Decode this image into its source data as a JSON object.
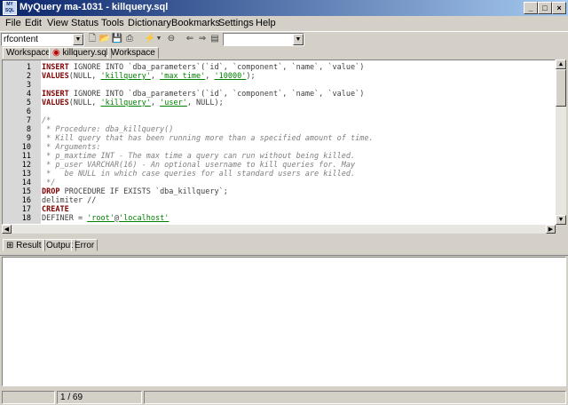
{
  "window": {
    "title": "MyQuery ma-1031 - killquery.sql",
    "icon_text": "MY SQL"
  },
  "menu": [
    "File",
    "Edit",
    "View",
    "Status",
    "Tools",
    "Dictionary",
    "Bookmarks",
    "Settings",
    "Help"
  ],
  "toolbar": {
    "connection_value": "rfcontent",
    "database_value": ""
  },
  "tabs": [
    {
      "label": "Workspace"
    },
    {
      "label": "killquery.sql"
    },
    {
      "label": "Workspace"
    }
  ],
  "editor": {
    "lines": [
      {
        "n": "1",
        "parts": [
          [
            "kw",
            "INSERT"
          ],
          [
            "id",
            " IGNORE INTO `dba_parameters`(`id`, `component`, `name`, `value`)"
          ]
        ]
      },
      {
        "n": "2",
        "parts": [
          [
            "kw",
            "VALUES"
          ],
          [
            "id",
            "(NULL, "
          ],
          [
            "str",
            "'killquery'"
          ],
          [
            "id",
            ", "
          ],
          [
            "str",
            "'max_time'"
          ],
          [
            "id",
            ", "
          ],
          [
            "str",
            "'10000'"
          ],
          [
            "id",
            ");"
          ]
        ]
      },
      {
        "n": "3",
        "parts": []
      },
      {
        "n": "4",
        "parts": [
          [
            "kw",
            "INSERT"
          ],
          [
            "id",
            " IGNORE INTO `dba_parameters`(`id`, `component`, `name`, `value`)"
          ]
        ]
      },
      {
        "n": "5",
        "parts": [
          [
            "kw",
            "VALUES"
          ],
          [
            "id",
            "(NULL, "
          ],
          [
            "str",
            "'killquery'"
          ],
          [
            "id",
            ", "
          ],
          [
            "str",
            "'user'"
          ],
          [
            "id",
            ", NULL);"
          ]
        ]
      },
      {
        "n": "6",
        "parts": []
      },
      {
        "n": "7",
        "parts": [
          [
            "cm",
            "/*"
          ]
        ]
      },
      {
        "n": "8",
        "parts": [
          [
            "cm",
            " * Procedure: dba_killquery()"
          ]
        ]
      },
      {
        "n": "9",
        "parts": [
          [
            "cm",
            " * Kill query that has been running more than a specified amount of time."
          ]
        ]
      },
      {
        "n": "10",
        "parts": [
          [
            "cm",
            " * Arguments:"
          ]
        ]
      },
      {
        "n": "11",
        "parts": [
          [
            "cm",
            " * p_maxtime INT - The max time a query can run without being killed."
          ]
        ]
      },
      {
        "n": "12",
        "parts": [
          [
            "cm",
            " * p_user VARCHAR(16) - An optional username to kill queries for. May"
          ]
        ]
      },
      {
        "n": "13",
        "parts": [
          [
            "cm",
            " *   be NULL in which case queries for all standard users are killed."
          ]
        ]
      },
      {
        "n": "14",
        "parts": [
          [
            "cm",
            " */"
          ]
        ]
      },
      {
        "n": "15",
        "parts": [
          [
            "kw",
            "DROP"
          ],
          [
            "id",
            " PROCEDURE IF EXISTS `dba_killquery`;"
          ]
        ]
      },
      {
        "n": "16",
        "parts": [
          [
            "id",
            "delimiter //"
          ]
        ]
      },
      {
        "n": "17",
        "parts": [
          [
            "kw",
            "CREATE"
          ]
        ]
      },
      {
        "n": "18",
        "parts": [
          [
            "id",
            "DEFINER = "
          ],
          [
            "str",
            "'root'"
          ],
          [
            "id",
            "@"
          ],
          [
            "str",
            "'localhost'"
          ]
        ]
      }
    ]
  },
  "result_tabs": [
    "Result",
    "Output",
    "Error"
  ],
  "status": {
    "position": "1 / 69"
  }
}
